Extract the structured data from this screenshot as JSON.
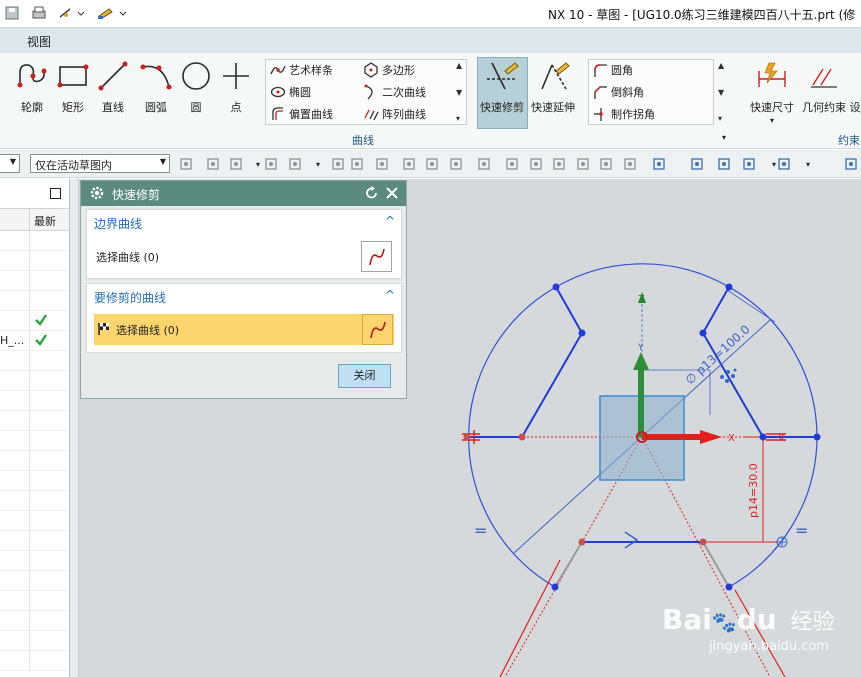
{
  "window": {
    "title": "NX 10 - 草图 - [UG10.0练习三维建模四百八十五.prt  (修"
  },
  "menu": {
    "view": "视图"
  },
  "ribbon": {
    "big_tools": [
      {
        "id": "profile",
        "label": "轮廓",
        "icon": "profile-icon"
      },
      {
        "id": "rectangle",
        "label": "矩形",
        "icon": "rectangle-icon"
      },
      {
        "id": "line",
        "label": "直线",
        "icon": "line-icon"
      },
      {
        "id": "arc",
        "label": "圆弧",
        "icon": "arc-icon"
      },
      {
        "id": "circle",
        "label": "圆",
        "icon": "circle-icon"
      },
      {
        "id": "point",
        "label": "点",
        "icon": "point-icon"
      }
    ],
    "curve_gallery": {
      "col1": [
        "艺术样条",
        "椭圆",
        "偏置曲线"
      ],
      "col2": [
        "多边形",
        "二次曲线",
        "阵列曲线"
      ]
    },
    "quick_trim": "快速修剪",
    "quick_extend": "快速延伸",
    "edit_gallery": [
      "圆角",
      "倒斜角",
      "制作拐角"
    ],
    "rapid_dimension": "快速尺寸",
    "geometric_constraint": "几何约束",
    "constraint_partial": "设",
    "group_curve": "曲线",
    "group_constraint": "约束"
  },
  "toolbar": {
    "filter_selected": "仅在活动草图内"
  },
  "navigator": {
    "column_latest": "最新",
    "row_partial": "H_..."
  },
  "dialog": {
    "title": "快速修剪",
    "boundary_section": "边界曲线",
    "boundary_select": "选择曲线 (0)",
    "trim_section": "要修剪的曲线",
    "trim_select": "选择曲线 (0)",
    "close_button": "关闭"
  },
  "sketch": {
    "z_label": "Z",
    "y_label": "Y",
    "x_label": "X",
    "x_label2": "X",
    "diameter_dim": "∅ p13=100.0",
    "length_dim": "p14=30.0",
    "equal_left": "=",
    "equal_right": "="
  },
  "watermark": {
    "brand": "Bai",
    "brand2": "du",
    "chinese": "经验",
    "url": "jingyan.baidu.com"
  },
  "colors": {
    "sketch_blue": "#1f3cd6",
    "dim_blue": "#3a63c8",
    "axis_red": "#e0201a",
    "axis_green": "#1e8a2e",
    "dialog_title": "#5b8a7f",
    "highlight_row": "#fcd56e"
  }
}
